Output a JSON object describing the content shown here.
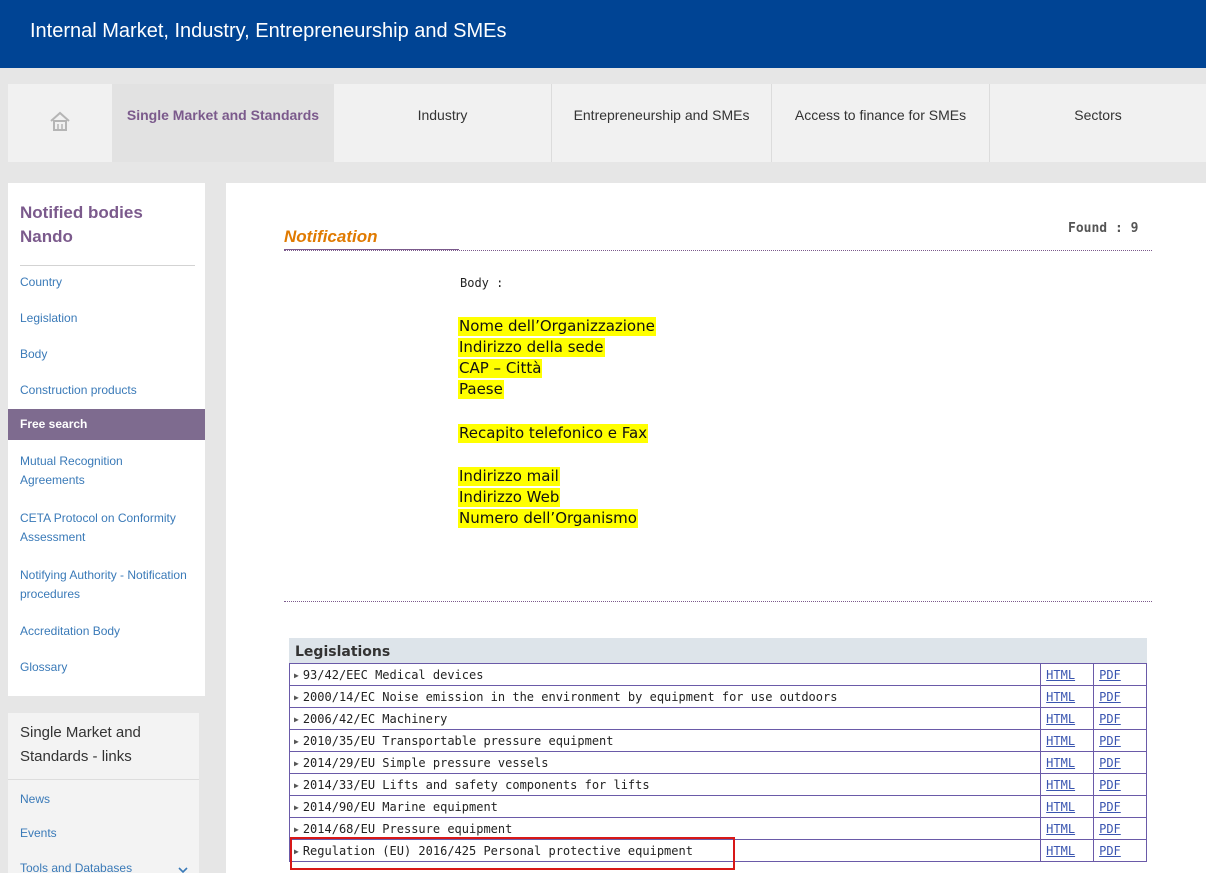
{
  "header": {
    "title": "Internal Market, Industry, Entrepreneurship and SMEs"
  },
  "nav": {
    "home_icon": "home-icon",
    "items": [
      {
        "label": "Single Market and Standards"
      },
      {
        "label": "Industry"
      },
      {
        "label": "Entrepreneurship and SMEs"
      },
      {
        "label": "Access to finance for SMEs"
      },
      {
        "label": "Sectors"
      }
    ]
  },
  "sidebar": {
    "title": "Notified bodies Nando",
    "items": [
      {
        "label": "Country"
      },
      {
        "label": "Legislation"
      },
      {
        "label": "Body"
      },
      {
        "label": "Construction products"
      },
      {
        "label": "Free search"
      },
      {
        "label": "Mutual Recognition Agreements"
      },
      {
        "label": "CETA Protocol on Conformity Assessment"
      },
      {
        "label": "Notifying Authority - Notification procedures"
      },
      {
        "label": "Accreditation Body"
      },
      {
        "label": "Glossary"
      }
    ]
  },
  "links_panel": {
    "title": "Single Market and Standards - links",
    "items": [
      {
        "label": "News"
      },
      {
        "label": "Events"
      },
      {
        "label": "Tools and Databases"
      }
    ]
  },
  "main": {
    "heading": "Notification",
    "found": "Found : 9",
    "body_label": "Body :",
    "highlighted": [
      "Nome dell’Organizzazione",
      "Indirizzo della sede",
      "CAP – Città",
      "Paese",
      "Recapito telefonico e Fax",
      "Indirizzo mail",
      "Indirizzo Web",
      "Numero dell’Organismo"
    ],
    "highlight_color": "#ffff00"
  },
  "legislations": {
    "heading": "Legislations",
    "html_label": "HTML",
    "pdf_label": "PDF",
    "rows": [
      {
        "name": "93/42/EEC Medical devices"
      },
      {
        "name": "2000/14/EC Noise emission in the environment by equipment for use outdoors"
      },
      {
        "name": "2006/42/EC Machinery"
      },
      {
        "name": "2010/35/EU Transportable pressure equipment"
      },
      {
        "name": "2014/29/EU Simple pressure vessels"
      },
      {
        "name": "2014/33/EU Lifts and safety components for lifts"
      },
      {
        "name": "2014/90/EU Marine equipment"
      },
      {
        "name": "2014/68/EU Pressure equipment"
      },
      {
        "name": "Regulation (EU) 2016/425 Personal protective equipment"
      }
    ]
  },
  "colors": {
    "header_blue": "#004494",
    "accent_purple": "#7b5a8c",
    "notification_orange": "#e07a00",
    "annotation_red": "#d81818"
  }
}
